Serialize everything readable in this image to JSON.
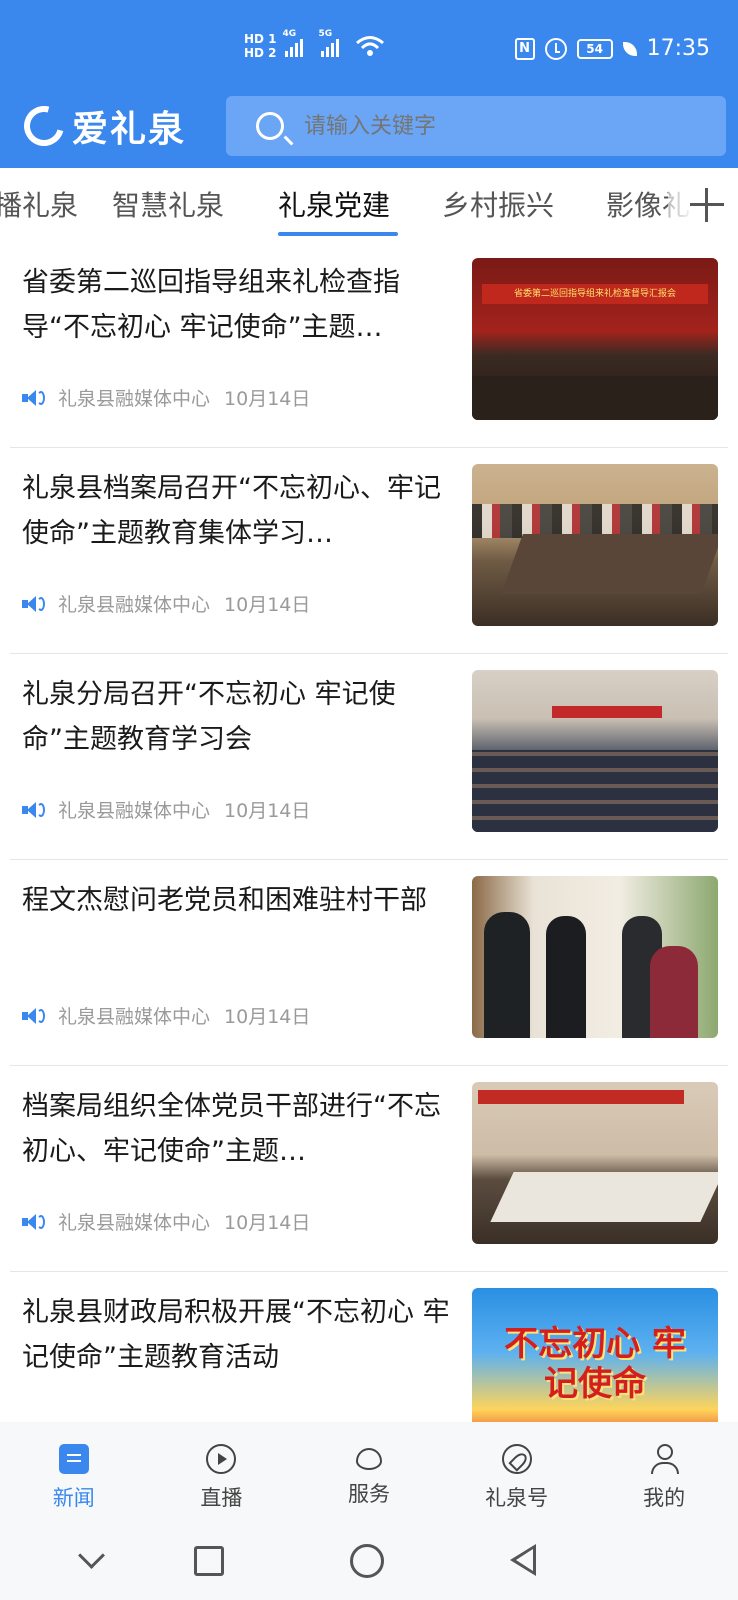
{
  "status_bar": {
    "hd1": "HD 1",
    "hd2": "HD 2",
    "net1": "4G",
    "net2": "5G",
    "nfc": "N",
    "battery": "54",
    "time": "17:35"
  },
  "app": {
    "name": "爱礼泉",
    "brand_color": "#3a87ee"
  },
  "search": {
    "placeholder": "请输入关键字"
  },
  "tabs": [
    {
      "label": "播礼泉",
      "active": false
    },
    {
      "label": "智慧礼泉",
      "active": false
    },
    {
      "label": "礼泉党建",
      "active": true
    },
    {
      "label": "乡村振兴",
      "active": false
    },
    {
      "label": "影像礼",
      "active": false
    }
  ],
  "news": [
    {
      "title": "省委第二巡回指导组来礼检查指导“不忘初心 牢记使命”主题…",
      "source": "礼泉县融媒体中心",
      "date": "10月14日"
    },
    {
      "title": "礼泉县档案局召开“不忘初心、牢记使命”主题教育集体学习…",
      "source": "礼泉县融媒体中心",
      "date": "10月14日"
    },
    {
      "title": "礼泉分局召开“不忘初心 牢记使命”主题教育学习会",
      "source": "礼泉县融媒体中心",
      "date": "10月14日"
    },
    {
      "title": "程文杰慰问老党员和困难驻村干部",
      "source": "礼泉县融媒体中心",
      "date": "10月14日"
    },
    {
      "title": "档案局组织全体党员干部进行“不忘初心、牢记使命”主题…",
      "source": "礼泉县融媒体中心",
      "date": "10月14日"
    },
    {
      "title": "礼泉县财政局积极开展“不忘初心 牢记使命”主题教育活动",
      "source": "",
      "date": ""
    }
  ],
  "thumb_text": {
    "t1_banner": "省委第二巡回指导组来礼检查督导汇报会",
    "t6_text": "不忘初心 牢记使命"
  },
  "bottom_nav": [
    {
      "label": "新闻",
      "icon": "news-icon",
      "active": true
    },
    {
      "label": "直播",
      "icon": "play-icon",
      "active": false
    },
    {
      "label": "服务",
      "icon": "service-icon",
      "active": false
    },
    {
      "label": "礼泉号",
      "icon": "compass-icon",
      "active": false
    },
    {
      "label": "我的",
      "icon": "user-icon",
      "active": false
    }
  ]
}
